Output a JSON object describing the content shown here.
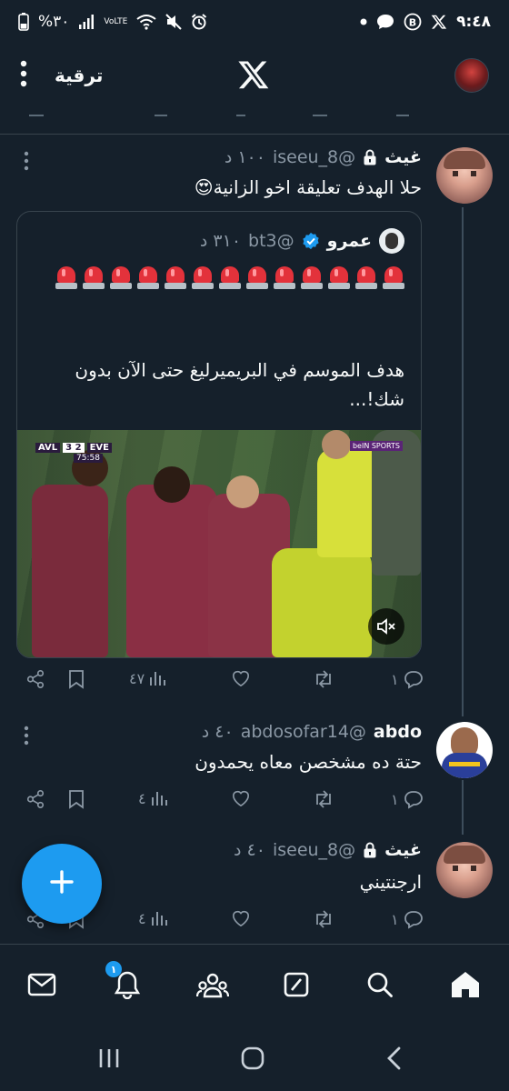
{
  "status_bar": {
    "time": "٩:٤٨",
    "battery": "%٣٠",
    "network_label": "VoLTE",
    "icons_left": [
      "battery-icon",
      "signal-icon",
      "volte-icon",
      "wifi-icon",
      "mute-icon",
      "alarm-icon"
    ],
    "icons_right": [
      "x-notification-icon",
      "bitcoin-icon",
      "messages-icon",
      "dot-icon"
    ]
  },
  "header": {
    "upgrade_label": "ترقية",
    "logo": "x-logo-icon",
    "menu_icon": "more-vertical-icon"
  },
  "tweets": [
    {
      "name": "غيث",
      "handle": "@iseeu_8",
      "time": "١٠٠ د",
      "protected": true,
      "text": "حلا الهدف تعليقة اخو الزانية😍",
      "quote": {
        "name": "عمرو",
        "handle": "@bt3",
        "time": "٣١٠ د",
        "verified": true,
        "siren_count": 13,
        "text": "هدف الموسم في البريميرليغ حتى الآن بدون شك!...",
        "video": {
          "scoreboard_home": "AVL",
          "score": "3 2",
          "scoreboard_away": "EVE",
          "clock": "75:58",
          "broadcaster": "beIN SPORTS"
        }
      },
      "actions": {
        "replies": "١",
        "retweets": "",
        "likes": "",
        "views": "٤٧"
      }
    },
    {
      "name": "abdo",
      "handle": "@abdosofar14",
      "time": "٤٠ د",
      "protected": false,
      "text": "حتة ده مشخصن معاه يحمدون",
      "actions": {
        "replies": "١",
        "retweets": "",
        "likes": "",
        "views": "٤"
      }
    },
    {
      "name": "غيث",
      "handle": "@iseeu_8",
      "time": "٤٠ د",
      "protected": true,
      "text": "ارجنتيني",
      "actions": {
        "replies": "١",
        "retweets": "",
        "likes": "",
        "views": "٤"
      }
    }
  ],
  "fab": {
    "icon": "plus-icon"
  },
  "bottom_nav": {
    "items": [
      "home-icon",
      "search-icon",
      "grok-icon",
      "communities-icon",
      "notifications-icon",
      "messages-icon"
    ],
    "notification_badge": "١",
    "active": "home-icon"
  },
  "system_nav": [
    "recents-icon",
    "home-circle-icon",
    "back-icon"
  ],
  "colors": {
    "background": "#15202b",
    "accent": "#1d9bf0",
    "text": "#f7f9f9",
    "muted": "#8b98a5",
    "border": "#38444d"
  }
}
